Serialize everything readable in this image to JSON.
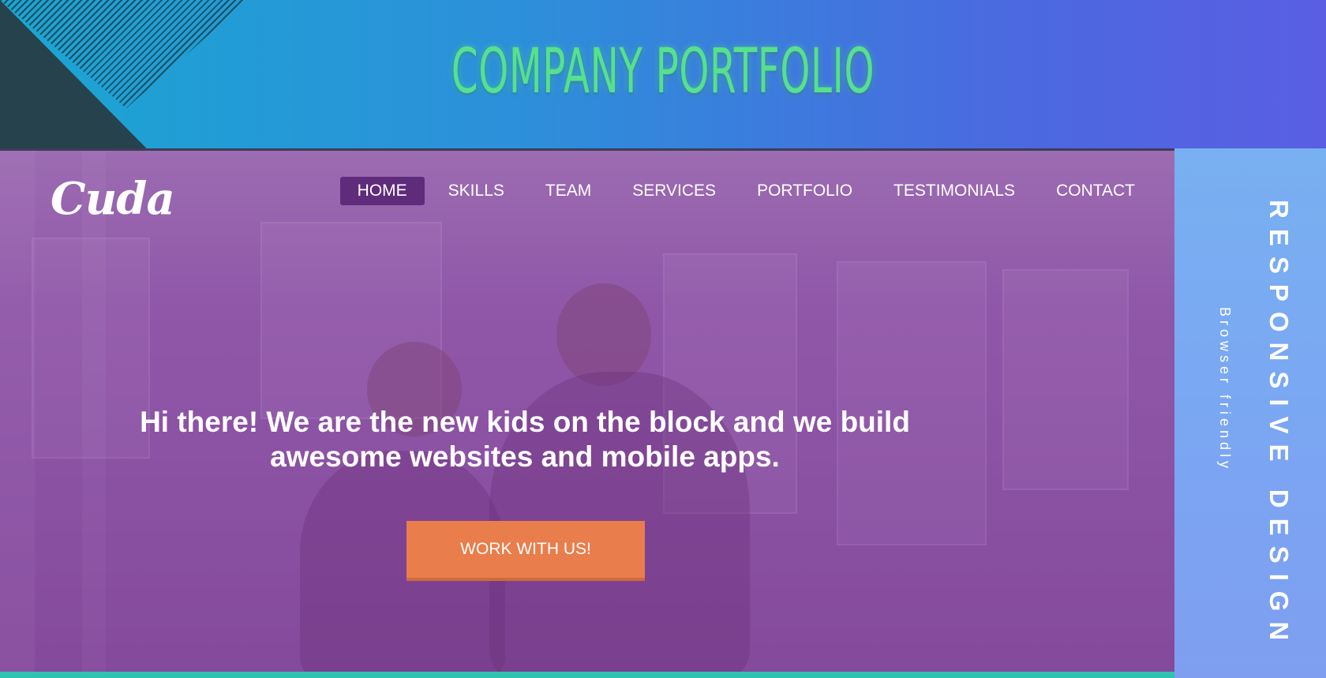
{
  "banner": {
    "title": "COMPANY PORTFOLIO"
  },
  "site": {
    "logo": "Cuda",
    "nav": [
      {
        "label": "HOME",
        "active": true
      },
      {
        "label": "SKILLS",
        "active": false
      },
      {
        "label": "TEAM",
        "active": false
      },
      {
        "label": "SERVICES",
        "active": false
      },
      {
        "label": "PORTFOLIO",
        "active": false
      },
      {
        "label": "TESTIMONIALS",
        "active": false
      },
      {
        "label": "CONTACT",
        "active": false
      }
    ],
    "hero_text": "Hi there! We are the new kids on the block and we build awesome websites and mobile apps.",
    "cta_label": "WORK WITH US!"
  },
  "side_panel": {
    "title": "RESPONSIVE DESIGN",
    "subtitle": "Browser friendly"
  },
  "colors": {
    "banner_title": "#57e08f",
    "nav_active_bg": "#5e2c7b",
    "cta_bg": "#e97d4b",
    "side_panel_bg": "#7ba5f2",
    "bottom_accent": "#2fc4b0"
  }
}
